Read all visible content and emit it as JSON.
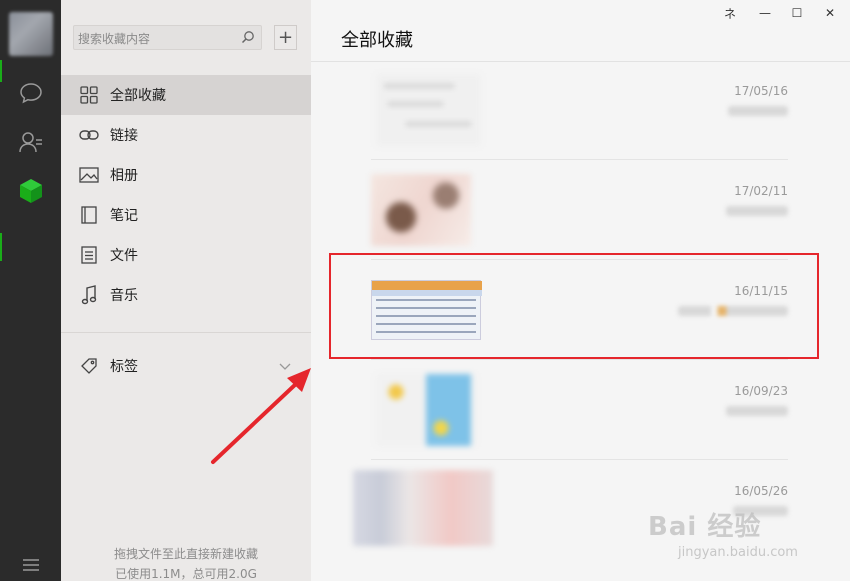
{
  "window": {
    "pin_glyph": "ネ",
    "minimize_glyph": "—",
    "maximize_glyph": "☐",
    "close_glyph": "✕"
  },
  "sidebar": {
    "search_placeholder": "搜索收藏内容",
    "add_label": "+",
    "categories": [
      {
        "label": "全部收藏",
        "icon": "grid-icon",
        "active": true
      },
      {
        "label": "链接",
        "icon": "link-icon",
        "active": false
      },
      {
        "label": "相册",
        "icon": "image-icon",
        "active": false
      },
      {
        "label": "笔记",
        "icon": "note-icon",
        "active": false
      },
      {
        "label": "文件",
        "icon": "file-icon",
        "active": false
      },
      {
        "label": "音乐",
        "icon": "music-icon",
        "active": false
      }
    ],
    "tags_label": "标签",
    "footer_hint": "拖拽文件至此直接新建收藏",
    "footer_usage": "已使用1.1M，总可用2.0G"
  },
  "main": {
    "title": "全部收藏",
    "items": [
      {
        "date": "17/05/16"
      },
      {
        "date": "17/02/11"
      },
      {
        "date": "16/11/15"
      },
      {
        "date": "16/09/23"
      },
      {
        "date": "16/05/26"
      }
    ]
  },
  "watermark": {
    "brand": "Bai  经验",
    "url": "jingyan.baidu.com"
  },
  "colors": {
    "nav_bg": "#2b2b2b",
    "panel_bg": "#ebe9e8",
    "accent_green": "#1aad19",
    "highlight_red": "#e5262c"
  }
}
